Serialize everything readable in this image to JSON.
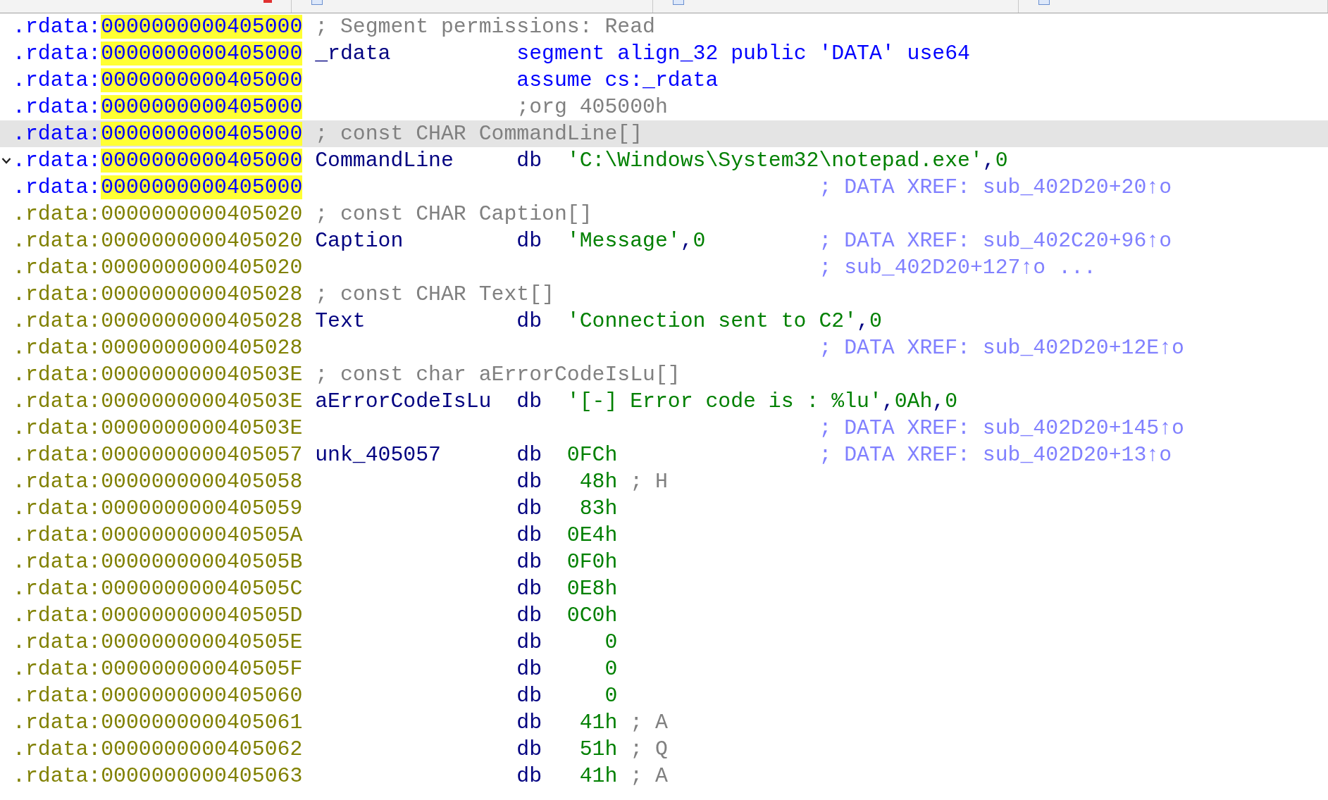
{
  "rows": [
    {
      "segment": ".rdata:",
      "address": "0000000000405000",
      "highlighted": true,
      "selected": false,
      "collapsible": false,
      "comment": "; Segment permissions: Read",
      "comment_xref": false
    },
    {
      "segment": ".rdata:",
      "address": "0000000000405000",
      "highlighted": true,
      "selected": false,
      "collapsible": false,
      "label": "_rdata",
      "directive": "segment align_32 public 'DATA' use64",
      "directive_muted": false
    },
    {
      "segment": ".rdata:",
      "address": "0000000000405000",
      "highlighted": true,
      "selected": false,
      "collapsible": false,
      "directive": "assume cs:_rdata",
      "directive_muted": false
    },
    {
      "segment": ".rdata:",
      "address": "0000000000405000",
      "highlighted": true,
      "selected": false,
      "collapsible": false,
      "directive": ";org 405000h",
      "directive_muted": true
    },
    {
      "segment": ".rdata:",
      "address": "0000000000405000",
      "highlighted": true,
      "selected": true,
      "collapsible": false,
      "comment": "; const CHAR CommandLine[]",
      "comment_xref": false
    },
    {
      "segment": ".rdata:",
      "address": "0000000000405000",
      "highlighted": true,
      "selected": false,
      "collapsible": true,
      "label": "CommandLine",
      "mnemonic": "db",
      "operand": "'C:\\Windows\\System32\\notepad.exe',0",
      "kind": "string"
    },
    {
      "segment": ".rdata:",
      "address": "0000000000405000",
      "highlighted": true,
      "selected": false,
      "collapsible": false,
      "comment": "; DATA XREF: sub_402D20+20↑o",
      "comment_xref": true
    },
    {
      "segment": ".rdata:",
      "address": "0000000000405020",
      "highlighted": false,
      "selected": false,
      "collapsible": false,
      "comment": "; const CHAR Caption[]",
      "comment_xref": false
    },
    {
      "segment": ".rdata:",
      "address": "0000000000405020",
      "highlighted": false,
      "selected": false,
      "collapsible": false,
      "label": "Caption",
      "mnemonic": "db",
      "operand": "'Message',0",
      "kind": "string",
      "comment": "; DATA XREF: sub_402C20+96↑o",
      "comment_xref": true
    },
    {
      "segment": ".rdata:",
      "address": "0000000000405020",
      "highlighted": false,
      "selected": false,
      "collapsible": false,
      "comment": "; sub_402D20+127↑o ...",
      "comment_xref": true
    },
    {
      "segment": ".rdata:",
      "address": "0000000000405028",
      "highlighted": false,
      "selected": false,
      "collapsible": false,
      "comment": "; const CHAR Text[]",
      "comment_xref": false
    },
    {
      "segment": ".rdata:",
      "address": "0000000000405028",
      "highlighted": false,
      "selected": false,
      "collapsible": false,
      "label": "Text",
      "mnemonic": "db",
      "operand": "'Connection sent to C2',0",
      "kind": "string"
    },
    {
      "segment": ".rdata:",
      "address": "0000000000405028",
      "highlighted": false,
      "selected": false,
      "collapsible": false,
      "comment": "; DATA XREF: sub_402D20+12E↑o",
      "comment_xref": true
    },
    {
      "segment": ".rdata:",
      "address": "000000000040503E",
      "highlighted": false,
      "selected": false,
      "collapsible": false,
      "comment": "; const char aErrorCodeIsLu[]",
      "comment_xref": false
    },
    {
      "segment": ".rdata:",
      "address": "000000000040503E",
      "highlighted": false,
      "selected": false,
      "collapsible": false,
      "label": "aErrorCodeIsLu",
      "mnemonic": "db",
      "operand": "'[-] Error code is : %lu',0Ah,0",
      "kind": "string"
    },
    {
      "segment": ".rdata:",
      "address": "000000000040503E",
      "highlighted": false,
      "selected": false,
      "collapsible": false,
      "comment": "; DATA XREF: sub_402D20+145↑o",
      "comment_xref": true
    },
    {
      "segment": ".rdata:",
      "address": "0000000000405057",
      "highlighted": false,
      "selected": false,
      "collapsible": false,
      "label": "unk_405057",
      "mnemonic": "db",
      "operand": "0FCh",
      "kind": "byte",
      "comment": "; DATA XREF: sub_402D20+13↑o",
      "comment_xref": true
    },
    {
      "segment": ".rdata:",
      "address": "0000000000405058",
      "highlighted": false,
      "selected": false,
      "collapsible": false,
      "mnemonic": "db",
      "operand": "48h",
      "kind": "byte",
      "comment": "; H",
      "comment_xref": false
    },
    {
      "segment": ".rdata:",
      "address": "0000000000405059",
      "highlighted": false,
      "selected": false,
      "collapsible": false,
      "mnemonic": "db",
      "operand": "83h",
      "kind": "byte"
    },
    {
      "segment": ".rdata:",
      "address": "000000000040505A",
      "highlighted": false,
      "selected": false,
      "collapsible": false,
      "mnemonic": "db",
      "operand": "0E4h",
      "kind": "byte"
    },
    {
      "segment": ".rdata:",
      "address": "000000000040505B",
      "highlighted": false,
      "selected": false,
      "collapsible": false,
      "mnemonic": "db",
      "operand": "0F0h",
      "kind": "byte"
    },
    {
      "segment": ".rdata:",
      "address": "000000000040505C",
      "highlighted": false,
      "selected": false,
      "collapsible": false,
      "mnemonic": "db",
      "operand": "0E8h",
      "kind": "byte"
    },
    {
      "segment": ".rdata:",
      "address": "000000000040505D",
      "highlighted": false,
      "selected": false,
      "collapsible": false,
      "mnemonic": "db",
      "operand": "0C0h",
      "kind": "byte"
    },
    {
      "segment": ".rdata:",
      "address": "000000000040505E",
      "highlighted": false,
      "selected": false,
      "collapsible": false,
      "mnemonic": "db",
      "operand": "0",
      "kind": "byte"
    },
    {
      "segment": ".rdata:",
      "address": "000000000040505F",
      "highlighted": false,
      "selected": false,
      "collapsible": false,
      "mnemonic": "db",
      "operand": "0",
      "kind": "byte"
    },
    {
      "segment": ".rdata:",
      "address": "0000000000405060",
      "highlighted": false,
      "selected": false,
      "collapsible": false,
      "mnemonic": "db",
      "operand": "0",
      "kind": "byte"
    },
    {
      "segment": ".rdata:",
      "address": "0000000000405061",
      "highlighted": false,
      "selected": false,
      "collapsible": false,
      "mnemonic": "db",
      "operand": "41h",
      "kind": "byte",
      "comment": "; A",
      "comment_xref": false
    },
    {
      "segment": ".rdata:",
      "address": "0000000000405062",
      "highlighted": false,
      "selected": false,
      "collapsible": false,
      "mnemonic": "db",
      "operand": "51h",
      "kind": "byte",
      "comment": "; Q",
      "comment_xref": false
    },
    {
      "segment": ".rdata:",
      "address": "0000000000405063",
      "highlighted": false,
      "selected": false,
      "collapsible": false,
      "mnemonic": "db",
      "operand": "41h",
      "kind": "byte",
      "comment": "; A",
      "comment_xref": false
    }
  ]
}
